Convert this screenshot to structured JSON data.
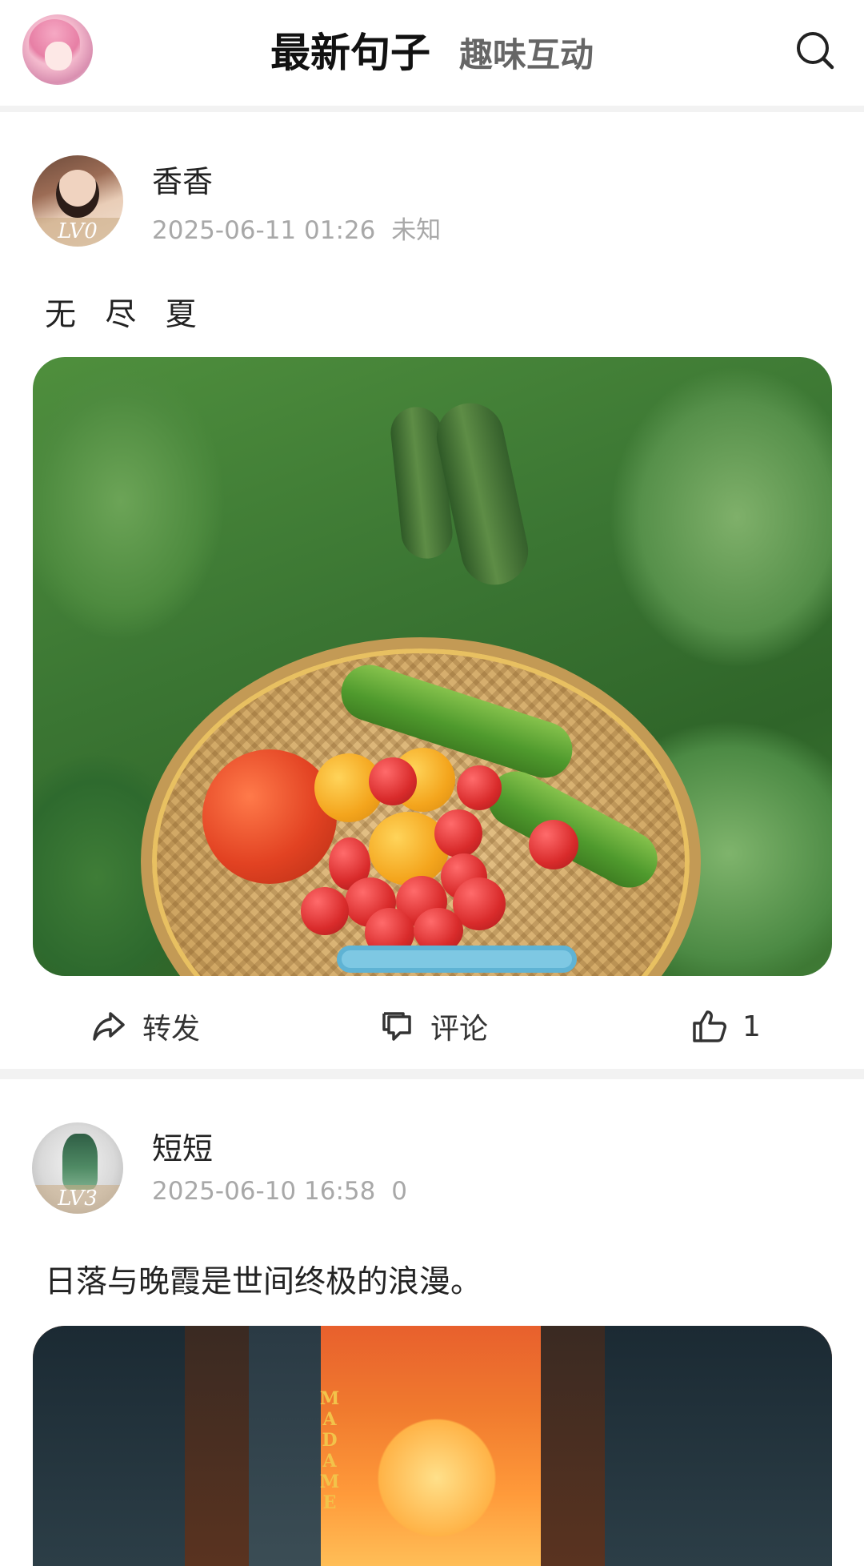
{
  "header": {
    "tabs": [
      {
        "label": "最新句子",
        "active": true
      },
      {
        "label": "趣味互动",
        "active": false
      }
    ],
    "icons": {
      "left": "user-avatar",
      "right": "search-icon"
    }
  },
  "posts": [
    {
      "username": "香香",
      "level": "LV0",
      "date": "2025-06-11 01:26",
      "location": "未知",
      "text": "无 尽 夏",
      "image_description": "garden-basket-photo",
      "actions": {
        "forward": "转发",
        "comment": "评论",
        "likes": "1"
      }
    },
    {
      "username": "短短",
      "level": "LV3",
      "date": "2025-06-10 16:58",
      "location": "0",
      "text": "日落与晚霞是世间终极的浪漫。",
      "image_description": "city-sunset-photo",
      "sign_text": "MADAME"
    }
  ],
  "colors": {
    "accent": "#111111",
    "muted": "#a8a8a8",
    "divider": "#f2f2f2"
  }
}
